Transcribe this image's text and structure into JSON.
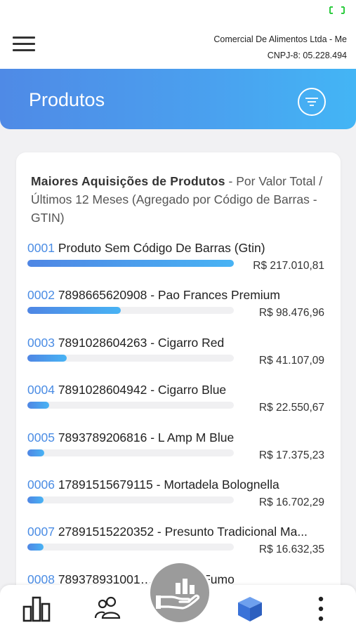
{
  "header": {
    "company_name": "Comercial De Alimentos Ltda - Me",
    "cnpj": "CNPJ-8: 05.228.494",
    "title": "Produtos"
  },
  "card": {
    "title_bold": "Maiores Aquisições de Produtos",
    "title_rest": " - Por Valor Total / Últimos 12 Meses (Agregado por Código de Barras - GTIN)",
    "items": [
      {
        "code": "0001",
        "name": "Produto Sem Código De Barras (Gtin)",
        "value": "R$ 217.010,81",
        "fraction": 1.0
      },
      {
        "code": "0002",
        "name": "7898665620908 - Pao Frances Premium",
        "value": "R$ 98.476,96",
        "fraction": 0.454
      },
      {
        "code": "0003",
        "name": "7891028604263 - Cigarro Red",
        "value": "R$ 41.107,09",
        "fraction": 0.189
      },
      {
        "code": "0004",
        "name": "7891028604942 - Cigarro Blue",
        "value": "R$ 22.550,67",
        "fraction": 0.104
      },
      {
        "code": "0005",
        "name": "7893789206816 - L Amp M Blue",
        "value": "R$ 17.375,23",
        "fraction": 0.08
      },
      {
        "code": "0006",
        "name": "17891515679115 - Mortadela Bolognella",
        "value": "R$ 16.702,29",
        "fraction": 0.077
      },
      {
        "code": "0007",
        "name": "27891515220352 - Presunto Tradicional Ma...",
        "value": "R$ 16.632,35",
        "fraction": 0.077
      },
      {
        "code": "0008",
        "name": "789378931001… Rios De Fumo",
        "value": "",
        "fraction": 0
      }
    ]
  },
  "nav": {
    "items": [
      {
        "icon": "bar-chart-icon",
        "active": false
      },
      {
        "icon": "users-icon",
        "active": false
      },
      {
        "icon": "hand-chart-icon",
        "active": false,
        "center": true
      },
      {
        "icon": "cube-icon",
        "active": true
      },
      {
        "icon": "more-vertical-icon",
        "active": false
      }
    ]
  },
  "colors": {
    "accent": "#4a8ce4",
    "header_gradient_start": "#4f8ae6",
    "header_gradient_end": "#43b5f5",
    "center_button": "#9b9b9b",
    "battery": "#2ecc40"
  }
}
